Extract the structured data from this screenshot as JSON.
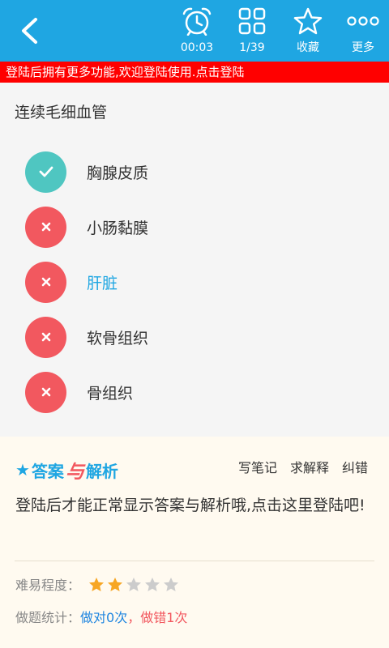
{
  "toolbar": {
    "timer": "00:03",
    "progress": "1/39",
    "favorite_label": "收藏",
    "more_label": "更多"
  },
  "banner": {
    "text": "登陆后拥有更多功能,欢迎登陆使用.点击登陆"
  },
  "question": {
    "title": "连续毛细血管",
    "options": [
      {
        "label": "胸腺皮质",
        "state": "correct"
      },
      {
        "label": "小肠黏膜",
        "state": "wrong"
      },
      {
        "label": "肝脏",
        "state": "wrong-selected"
      },
      {
        "label": "软骨组织",
        "state": "wrong"
      },
      {
        "label": "骨组织",
        "state": "wrong"
      }
    ]
  },
  "answer": {
    "logo_part1": "答案",
    "logo_part2": "与",
    "logo_part3": "解析",
    "actions": [
      "写笔记",
      "求解释",
      "纠错"
    ],
    "login_prompt": "登陆后才能正常显示答案与解析哦,点击这里登陆吧!",
    "difficulty_label": "难易程度：",
    "difficulty_rating": 2,
    "difficulty_max": 5,
    "stats_label": "做题统计：",
    "stats_right": "做对0次",
    "stats_sep": "，",
    "stats_wrong": "做错1次"
  },
  "colors": {
    "primary": "#1fa6e2",
    "banner": "#ff0000",
    "correct": "#4fc6c1",
    "wrong": "#f2585f",
    "star_on": "#f7a623",
    "star_off": "#cccccc"
  }
}
